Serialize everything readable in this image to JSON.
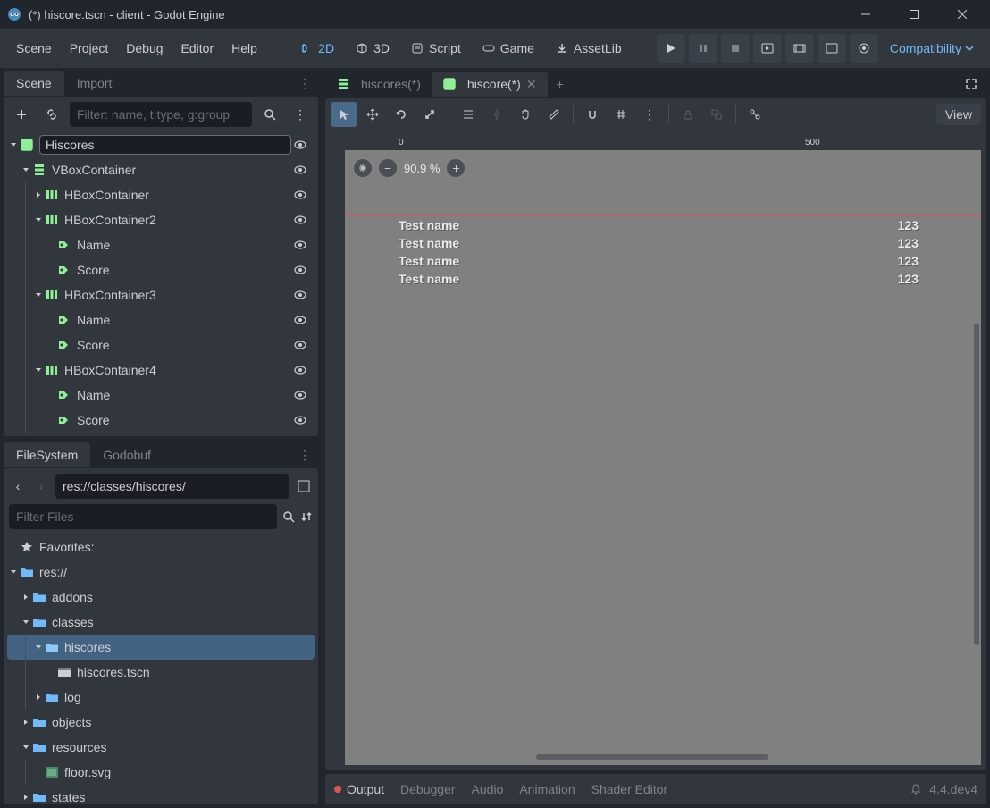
{
  "window": {
    "title": "(*) hiscore.tscn - client - Godot Engine"
  },
  "menu": {
    "scene": "Scene",
    "project": "Project",
    "debug": "Debug",
    "editor": "Editor",
    "help": "Help"
  },
  "modes": {
    "d2": "2D",
    "d3": "3D",
    "script": "Script",
    "game": "Game",
    "assetlib": "AssetLib"
  },
  "compat": "Compatibility",
  "docks": {
    "scene_tab": "Scene",
    "import_tab": "Import",
    "filter_placeholder": "Filter: name, t:type, g:group",
    "fs_tab": "FileSystem",
    "godobuf_tab": "Godobuf",
    "fs_path": "res://classes/hiscores/",
    "fs_filter_placeholder": "Filter Files"
  },
  "scene_tree": [
    {
      "level": 0,
      "arrow": "down",
      "icon": "control",
      "label": "Hiscores",
      "selected": true
    },
    {
      "level": 1,
      "arrow": "down",
      "icon": "vbox",
      "label": "VBoxContainer"
    },
    {
      "level": 2,
      "arrow": "right",
      "icon": "hbox",
      "label": "HBoxContainer"
    },
    {
      "level": 2,
      "arrow": "down",
      "icon": "hbox",
      "label": "HBoxContainer2"
    },
    {
      "level": 3,
      "arrow": "",
      "icon": "label",
      "label": "Name"
    },
    {
      "level": 3,
      "arrow": "",
      "icon": "label",
      "label": "Score"
    },
    {
      "level": 2,
      "arrow": "down",
      "icon": "hbox",
      "label": "HBoxContainer3"
    },
    {
      "level": 3,
      "arrow": "",
      "icon": "label",
      "label": "Name"
    },
    {
      "level": 3,
      "arrow": "",
      "icon": "label",
      "label": "Score"
    },
    {
      "level": 2,
      "arrow": "down",
      "icon": "hbox",
      "label": "HBoxContainer4"
    },
    {
      "level": 3,
      "arrow": "",
      "icon": "label",
      "label": "Name"
    },
    {
      "level": 3,
      "arrow": "",
      "icon": "label",
      "label": "Score"
    }
  ],
  "file_tree": {
    "favorites": "Favorites:",
    "root": "res://",
    "items": [
      {
        "level": 1,
        "arrow": "right",
        "icon": "folder",
        "label": "addons"
      },
      {
        "level": 1,
        "arrow": "down",
        "icon": "folder",
        "label": "classes"
      },
      {
        "level": 2,
        "arrow": "down",
        "icon": "folder-open",
        "label": "hiscores",
        "selected": true
      },
      {
        "level": 3,
        "arrow": "",
        "icon": "scene",
        "label": "hiscores.tscn"
      },
      {
        "level": 2,
        "arrow": "right",
        "icon": "folder",
        "label": "log"
      },
      {
        "level": 1,
        "arrow": "right",
        "icon": "folder",
        "label": "objects"
      },
      {
        "level": 1,
        "arrow": "down",
        "icon": "folder",
        "label": "resources"
      },
      {
        "level": 2,
        "arrow": "",
        "icon": "image",
        "label": "floor.svg"
      },
      {
        "level": 1,
        "arrow": "right",
        "icon": "folder",
        "label": "states"
      }
    ]
  },
  "editor_tabs": [
    {
      "label": "hiscores(*)",
      "icon": "vbox",
      "active": false,
      "close": false
    },
    {
      "label": "hiscore(*)",
      "icon": "control",
      "active": true,
      "close": true
    }
  ],
  "viewport": {
    "view_btn": "View",
    "zoom": "90.9 %",
    "rows": [
      {
        "name": "Test name",
        "score": "123"
      },
      {
        "name": "Test name",
        "score": "123"
      },
      {
        "name": "Test name",
        "score": "123"
      },
      {
        "name": "Test name",
        "score": "123"
      }
    ],
    "ruler_labels": {
      "zero": "0",
      "five_hundred": "500"
    }
  },
  "bottom": {
    "output": "Output",
    "debugger": "Debugger",
    "audio": "Audio",
    "animation": "Animation",
    "shader": "Shader Editor",
    "version": "4.4.dev4"
  }
}
